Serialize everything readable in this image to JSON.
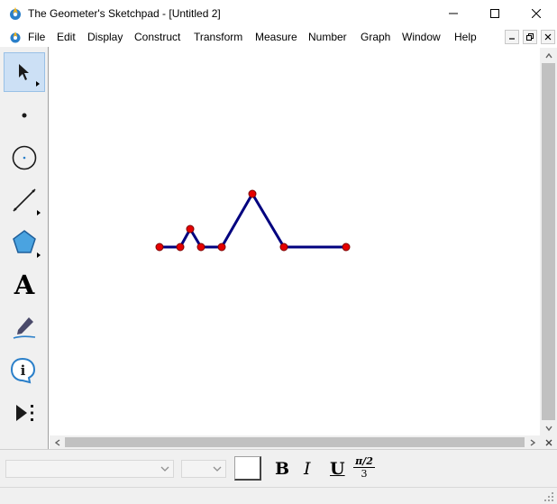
{
  "window": {
    "title": "The Geometer's Sketchpad - [Untitled 2]"
  },
  "menubar": {
    "items": [
      {
        "label": "File"
      },
      {
        "label": "Edit"
      },
      {
        "label": "Display"
      },
      {
        "label": "Construct"
      },
      {
        "label": "Transform"
      },
      {
        "label": "Measure"
      },
      {
        "label": "Number"
      },
      {
        "label": "Graph"
      },
      {
        "label": "Window"
      },
      {
        "label": "Help"
      }
    ]
  },
  "toolbox": {
    "tools": [
      {
        "name": "arrow-tool",
        "icon": "arrow-pointer-icon",
        "selected": true
      },
      {
        "name": "point-tool",
        "icon": "point-icon",
        "selected": false
      },
      {
        "name": "compass-tool",
        "icon": "compass-icon",
        "selected": false
      },
      {
        "name": "straightedge-tool",
        "icon": "straightedge-icon",
        "selected": false
      },
      {
        "name": "polygon-tool",
        "icon": "polygon-icon",
        "selected": false
      },
      {
        "name": "text-tool",
        "icon": "text-icon",
        "label": "A",
        "selected": false
      },
      {
        "name": "marker-tool",
        "icon": "marker-icon",
        "selected": false
      },
      {
        "name": "information-tool",
        "icon": "info-icon",
        "label": "i",
        "selected": false
      },
      {
        "name": "custom-tool",
        "icon": "custom-tool-icon",
        "selected": false
      }
    ]
  },
  "sketch": {
    "segment_color": "#00007f",
    "point_color": "#e60000"
  },
  "textbar": {
    "bold_label": "B",
    "italic_label": "I",
    "underline_label": "U",
    "math_label_top": "π/2",
    "math_label_bottom": "3"
  }
}
